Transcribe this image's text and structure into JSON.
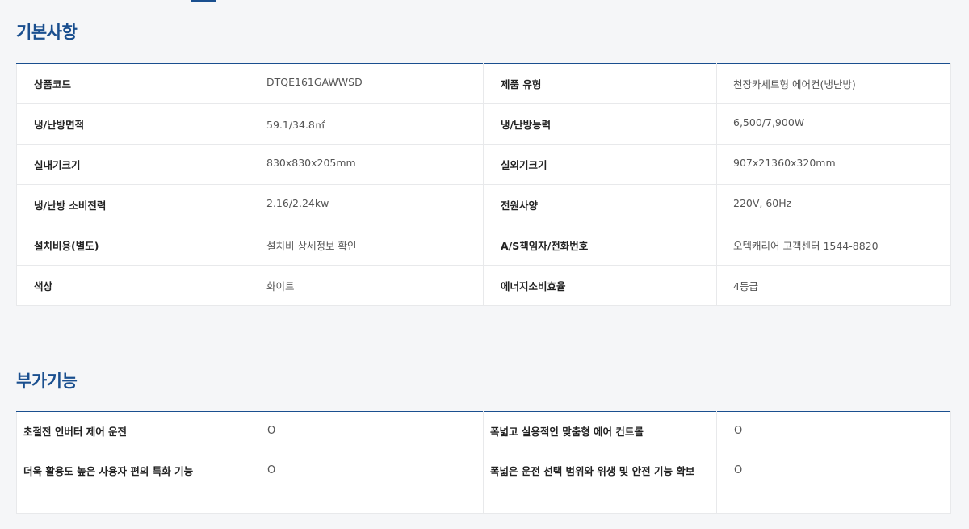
{
  "basic": {
    "title": "기본사항",
    "rows": [
      {
        "label1": "상품코드",
        "value1": "DTQE161GAWWSD",
        "label2": "제품 유형",
        "value2": "천장카세트형 에어컨(냉난방)"
      },
      {
        "label1": "냉/난방면적",
        "value1": "59.1/34.8㎡",
        "label2": "냉/난방능력",
        "value2": "6,500/7,900W"
      },
      {
        "label1": "실내기크기",
        "value1": "830x830x205mm",
        "label2": "실외기크기",
        "value2": "907x21360x320mm"
      },
      {
        "label1": "냉/난방 소비전력",
        "value1": "2.16/2.24kw",
        "label2": "전원사양",
        "value2": "220V, 60Hz"
      },
      {
        "label1": "설치비용(별도)",
        "value1": "설치비 상세정보 확인",
        "label2": "A/S책임자/전화번호",
        "value2": "오텍캐리어 고객센터 1544-8820"
      },
      {
        "label1": "색상",
        "value1": "화이트",
        "label2": "에너지소비효율",
        "value2": "4등급"
      }
    ]
  },
  "extra": {
    "title": "부가기능",
    "rows": [
      {
        "label1": "초절전 인버터 제어 운전",
        "value1": "O",
        "label2": "폭넓고 실용적인 맞춤형 에어 컨트롤",
        "value2": "O"
      },
      {
        "label1": "더욱 활용도 높은 사용자 편의 특화 기능",
        "value1": "O",
        "label2": "폭넓은 운전 선택 범위와 위생 및 안전 기능 확보",
        "value2": "O"
      }
    ]
  }
}
